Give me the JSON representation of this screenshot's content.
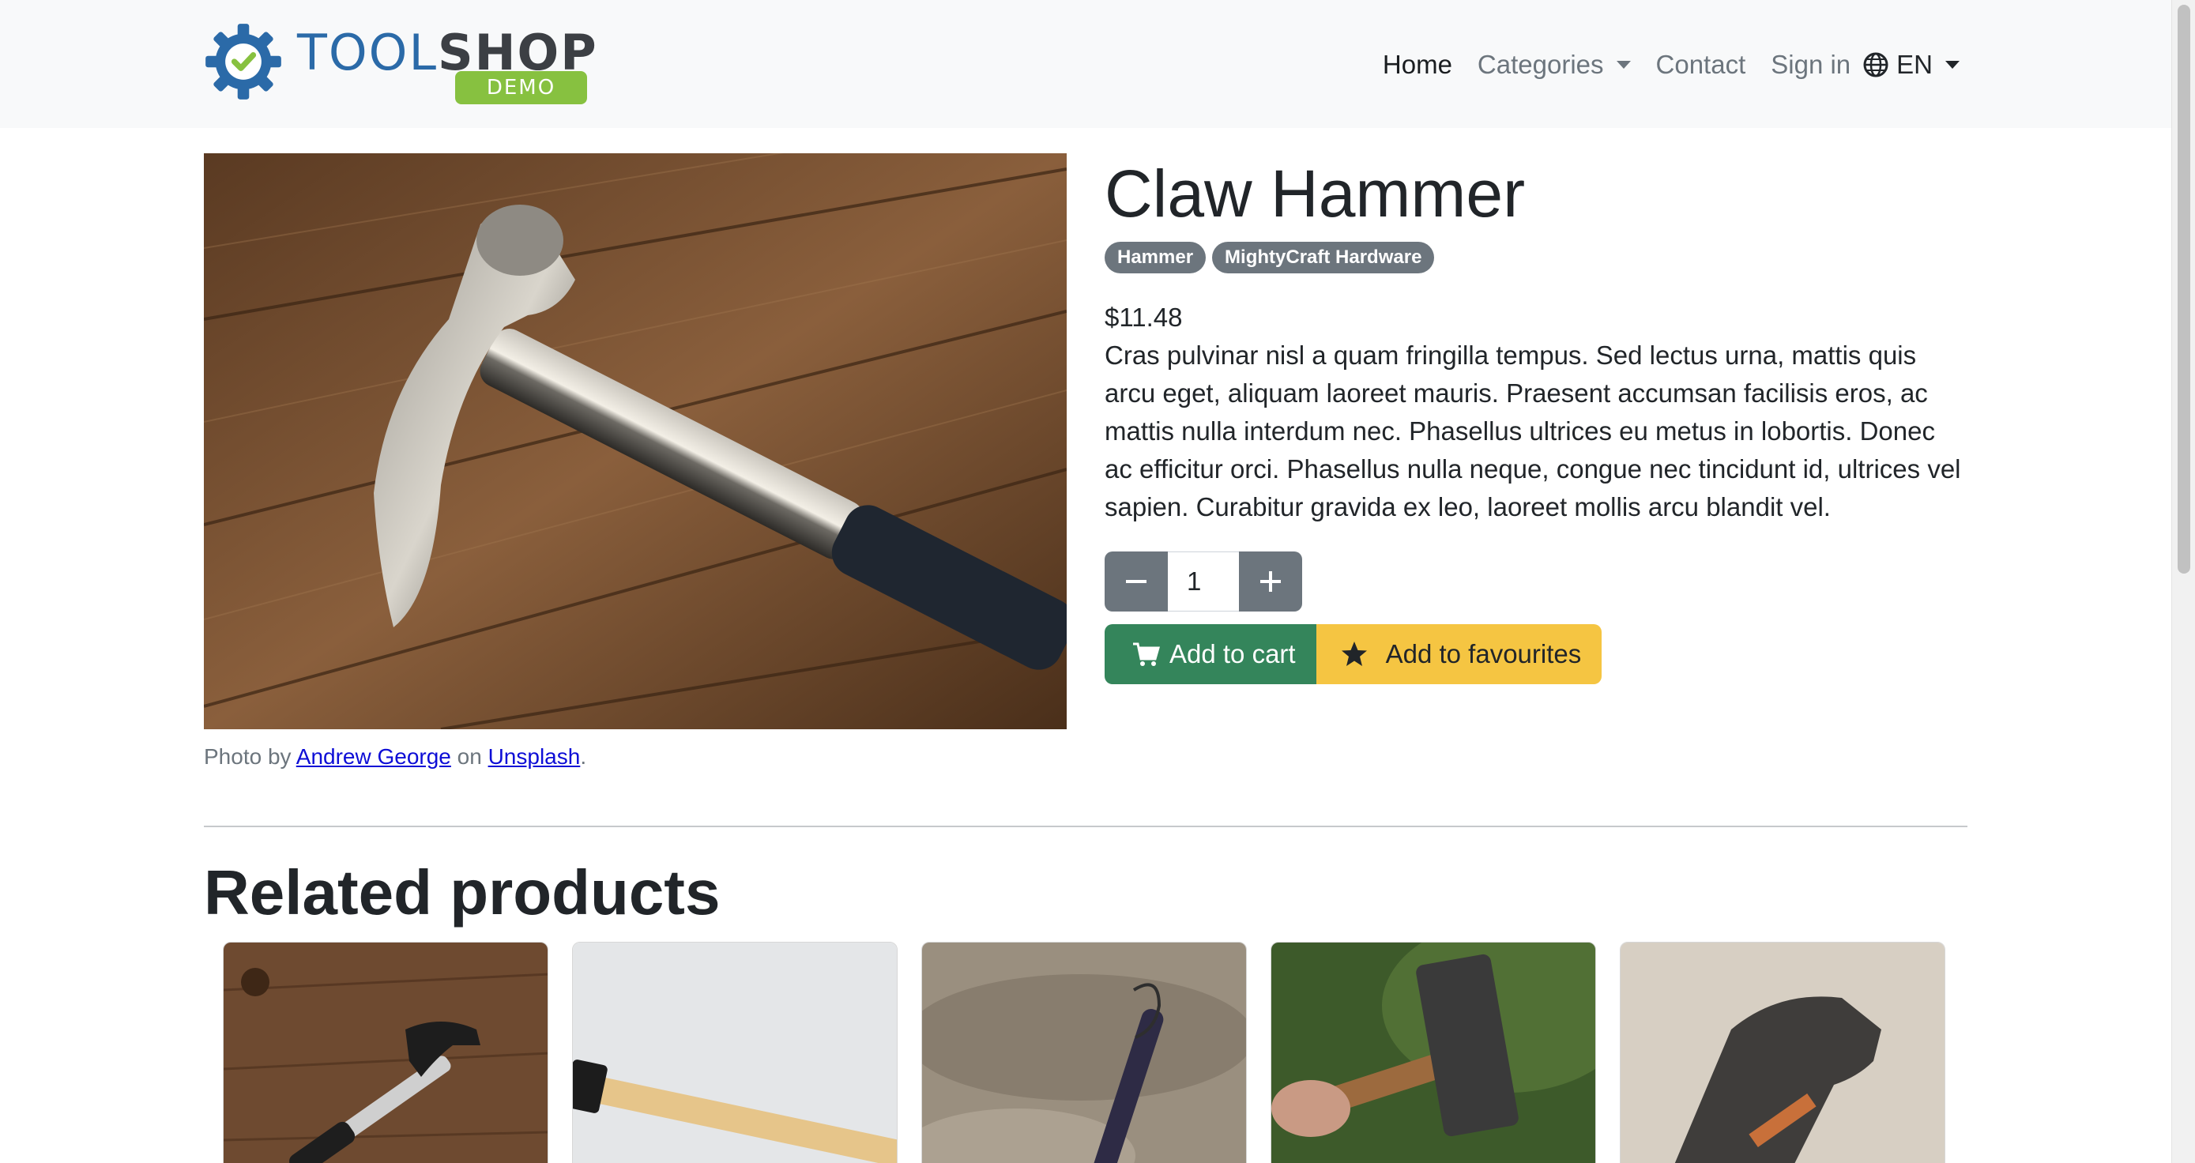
{
  "logo": {
    "tool": "TOOL",
    "shop": "SHOP",
    "demo": "DEMO",
    "colors": {
      "tool": "#2b6aa8",
      "shop": "#3c3f44",
      "demo": "#87c140"
    }
  },
  "nav": {
    "home": "Home",
    "categories": "Categories",
    "contact": "Contact",
    "signin": "Sign in",
    "language": "EN"
  },
  "product": {
    "title": "Claw Hammer",
    "badges": [
      "Hammer",
      "MightyCraft Hardware"
    ],
    "price": "$11.48",
    "description": "Cras pulvinar nisl a quam fringilla tempus. Sed lectus urna, mattis quis arcu eget, aliquam laoreet mauris. Praesent accumsan facilisis eros, ac mattis nulla interdum nec. Phasellus ultrices eu metus in lobortis. Donec ac efficitur orci. Phasellus nulla neque, congue nec tincidunt id, ultrices vel sapien. Curabitur gravida ex leo, laoreet mollis arcu blandit vel.",
    "quantity": "1",
    "add_to_cart": "Add to cart",
    "add_to_favourites": "Add to favourites"
  },
  "credit": {
    "prefix": "Photo by ",
    "author": "Andrew George",
    "middle": " on ",
    "source": "Unsplash",
    "suffix": "."
  },
  "related": {
    "title": "Related products"
  },
  "icons": [
    "globe-icon",
    "chevron-down-icon",
    "minus-icon",
    "plus-icon",
    "cart-icon",
    "star-icon",
    "gear-logo-icon"
  ],
  "colors": {
    "cart": "#34855b",
    "favourites": "#f5c542",
    "badge": "#6c757d",
    "navbar": "#f8f9fa"
  }
}
